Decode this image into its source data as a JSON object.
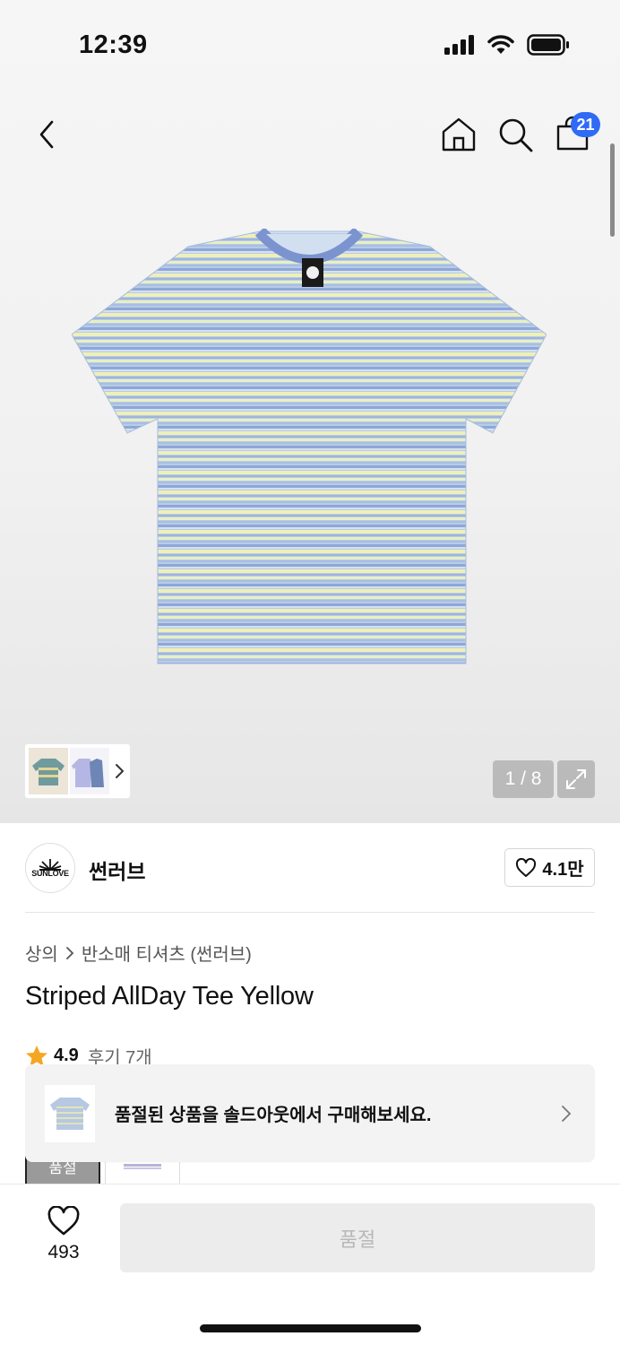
{
  "status_bar": {
    "time": "12:39"
  },
  "nav": {
    "cart_count": "21"
  },
  "gallery": {
    "page_indicator": "1 / 8"
  },
  "brand": {
    "name": "썬러브",
    "logo_text": "SUNLOVE",
    "like_count": "4.1만"
  },
  "breadcrumb": {
    "category": "상의",
    "subcategory": "반소매 티셔츠 (썬러브)"
  },
  "product": {
    "title": "Striped AllDay Tee Yellow",
    "rating": "4.9",
    "review_label": "후기 7개"
  },
  "options": {
    "soldout_label": "품절"
  },
  "toast": {
    "message": "품절된 상품을 솔드아웃에서 구매해보세요."
  },
  "bottom_bar": {
    "wish_count": "493",
    "action_label": "품절"
  },
  "colors": {
    "accent_badge": "#2f6bf5",
    "star": "#f5a623",
    "stripe_blue": "#9fb4dd",
    "stripe_yellow": "#eef0b8",
    "collar": "#7b93cf"
  }
}
